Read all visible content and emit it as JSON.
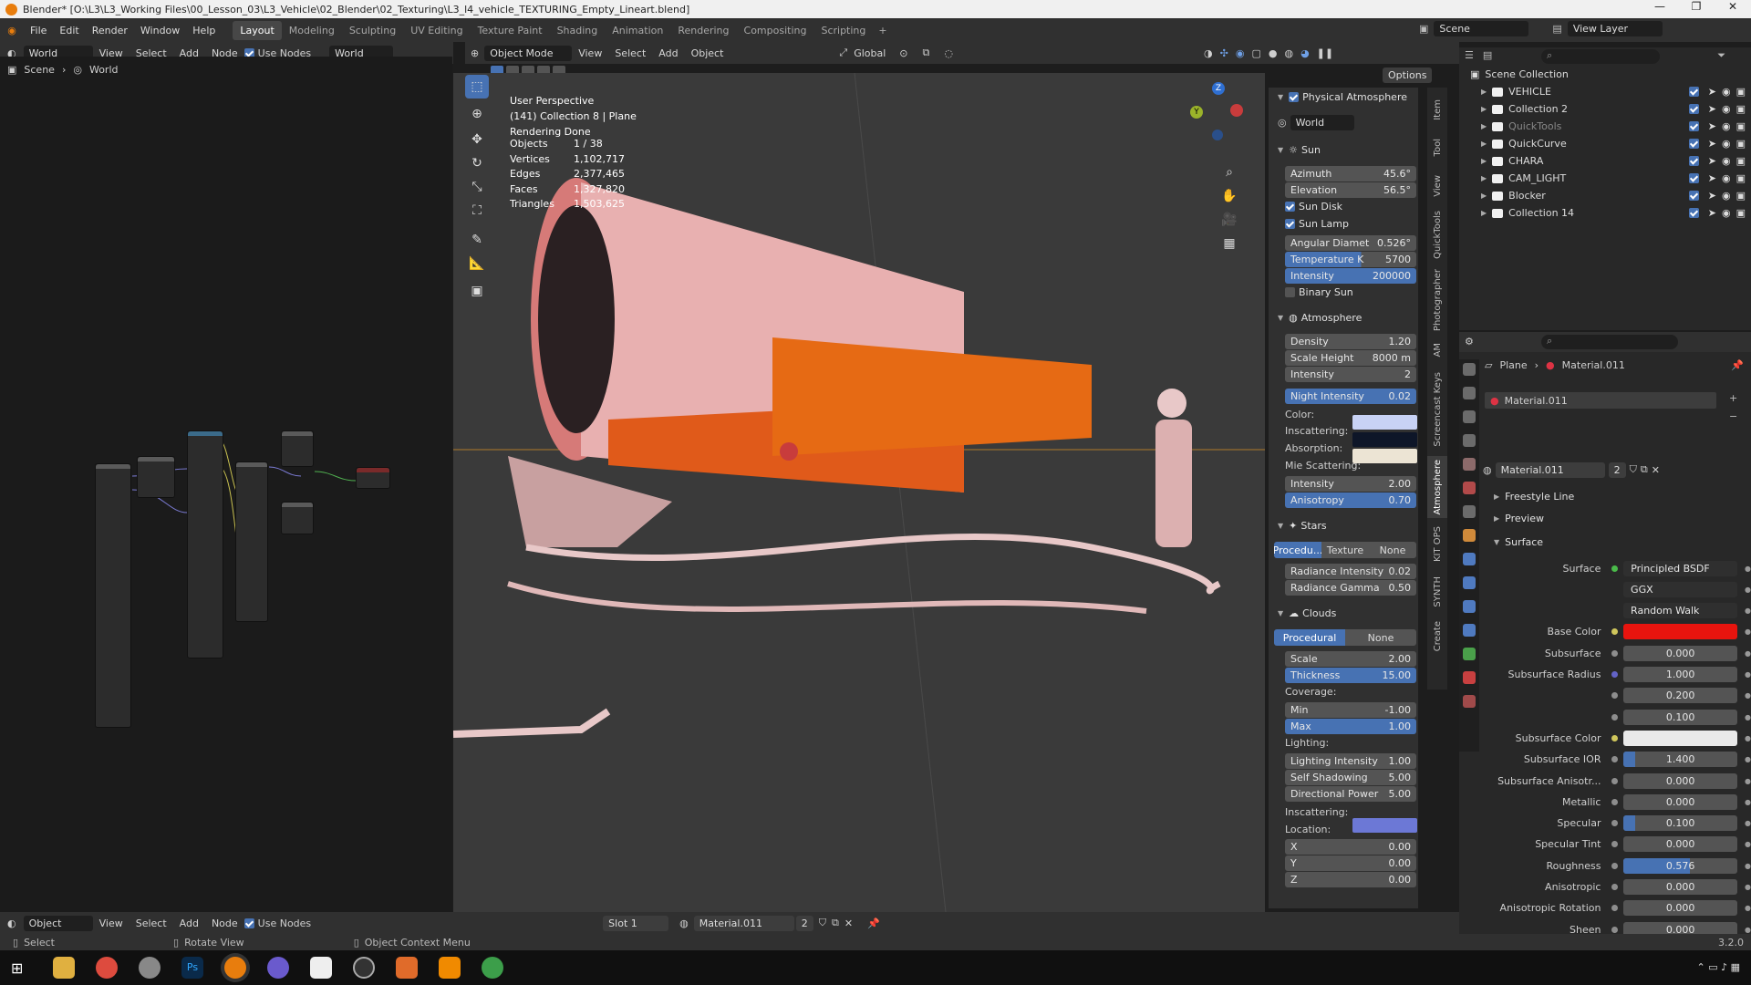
{
  "window": {
    "title": "Blender* [O:\\L3\\L3_Working Files\\00_Lesson_03\\L3_Vehicle\\02_Blender\\02_Texturing\\L3_l4_vehicle_TEXTURING_Empty_Lineart.blend]",
    "minimize": "—",
    "maximize": "❐",
    "close": "✕"
  },
  "topbar": {
    "menus": [
      "File",
      "Edit",
      "Render",
      "Window",
      "Help"
    ],
    "workspaces": [
      "Layout",
      "Modeling",
      "Sculpting",
      "UV Editing",
      "Texture Paint",
      "Shading",
      "Animation",
      "Rendering",
      "Compositing",
      "Scripting"
    ],
    "active_workspace": "Layout",
    "plus": "+",
    "scene_label": "Scene",
    "view_layer_label": "View Layer"
  },
  "node_header": {
    "world_type": "World",
    "menus": [
      "View",
      "Select",
      "Add",
      "Node"
    ],
    "use_nodes": "Use Nodes",
    "world_name": "World",
    "breadcrumb": [
      "Scene",
      "World"
    ]
  },
  "view3d_header": {
    "mode": "Object Mode",
    "menus": [
      "View",
      "Select",
      "Add",
      "Object"
    ],
    "orientation": "Global",
    "options": "Options"
  },
  "viewport": {
    "perspective": "User Perspective",
    "collection_info": "(141) Collection 8 | Plane",
    "render_status": "Rendering Done",
    "stats": [
      {
        "label": "Objects",
        "value": "1 / 38"
      },
      {
        "label": "Vertices",
        "value": "1,102,717"
      },
      {
        "label": "Edges",
        "value": "2,377,465"
      },
      {
        "label": "Faces",
        "value": "1,327,820"
      },
      {
        "label": "Triangles",
        "value": "1,503,625"
      }
    ],
    "gizmo": {
      "z": "Z",
      "y": "Y"
    }
  },
  "physical_atmosphere": {
    "title": "Physical Atmosphere",
    "world": "World",
    "sun": {
      "title": "Sun",
      "azimuth_label": "Azimuth",
      "azimuth": "45.6°",
      "elevation_label": "Elevation",
      "elevation": "56.5°",
      "sun_disk": "Sun Disk",
      "sun_lamp": "Sun Lamp",
      "angular_label": "Angular Diamet",
      "angular": "0.526°",
      "temperature_label": "Temperature K",
      "temperature": "5700",
      "intensity_label": "Intensity",
      "intensity": "200000",
      "binary_sun": "Binary Sun"
    },
    "atmosphere": {
      "title": "Atmosphere",
      "density_label": "Density",
      "density": "1.20",
      "scale_label": "Scale Height",
      "scale": "8000 m",
      "intensity_label": "Intensity",
      "intensity": "2",
      "night_label": "Night Intensity",
      "night": "0.02",
      "color_label": "Color:",
      "inscattering_label": "Inscattering:",
      "absorption_label": "Absorption:",
      "mie_label": "Mie Scattering:",
      "mie_intensity_label": "Intensity",
      "mie_intensity": "2.00",
      "anisotropy_label": "Anisotropy",
      "anisotropy": "0.70"
    },
    "stars": {
      "title": "Stars",
      "modes": [
        "Procedu...",
        "Texture",
        "None"
      ],
      "radiance_intensity_label": "Radiance Intensity",
      "radiance_intensity": "0.02",
      "radiance_gamma_label": "Radiance Gamma",
      "radiance_gamma": "0.50"
    },
    "clouds": {
      "title": "Clouds",
      "modes": [
        "Procedural",
        "None"
      ],
      "scale_label": "Scale",
      "scale": "2.00",
      "thickness_label": "Thickness",
      "thickness": "15.00",
      "coverage_label": "Coverage:",
      "min_label": "Min",
      "min": "-1.00",
      "max_label": "Max",
      "max": "1.00",
      "lighting_label": "Lighting:",
      "lighting_intensity_label": "Lighting Intensity",
      "lighting_intensity": "1.00",
      "self_shadowing_label": "Self Shadowing",
      "self_shadowing": "5.00",
      "directional_label": "Directional Power",
      "directional": "5.00",
      "inscattering_label": "Inscattering:",
      "location_label": "Location:",
      "x_label": "X",
      "x": "0.00",
      "y_label": "Y",
      "y": "0.00",
      "z_label": "Z",
      "z": "0.00"
    }
  },
  "side_tabs": [
    "Item",
    "Tool",
    "View",
    "QuickTools",
    "Photographer",
    "AM",
    "Screencast Keys",
    "Atmosphere",
    "KIT OPS",
    "SYNTH",
    "Create"
  ],
  "outliner": {
    "title": "Scene Collection",
    "items": [
      {
        "name": "VEHICLE"
      },
      {
        "name": "Collection 2"
      },
      {
        "name": "QuickTools"
      },
      {
        "name": "QuickCurve"
      },
      {
        "name": "CHARA"
      },
      {
        "name": "CAM_LIGHT"
      },
      {
        "name": "Blocker"
      },
      {
        "name": "Collection 14"
      }
    ]
  },
  "properties": {
    "breadcrumb": [
      "Plane",
      "Material.011"
    ],
    "slot": "Material.011",
    "material": "Material.011",
    "users": "2",
    "sections": {
      "freestyle": "Freestyle Line",
      "preview": "Preview",
      "surface": "Surface"
    },
    "rows": [
      {
        "label": "Surface",
        "value": "Principled BSDF",
        "kind": "shader"
      },
      {
        "label": "",
        "value": "GGX",
        "kind": "dropdown"
      },
      {
        "label": "",
        "value": "Random Walk",
        "kind": "dropdown"
      },
      {
        "label": "Base Color",
        "value": "",
        "kind": "color",
        "color": "#e8140e"
      },
      {
        "label": "Subsurface",
        "value": "0.000",
        "kind": "num"
      },
      {
        "label": "Subsurface Radius",
        "value": "1.000",
        "kind": "vec"
      },
      {
        "label": "",
        "value": "0.200",
        "kind": "num"
      },
      {
        "label": "",
        "value": "0.100",
        "kind": "num"
      },
      {
        "label": "Subsurface Color",
        "value": "",
        "kind": "color",
        "color": "#e9e9e9"
      },
      {
        "label": "Subsurface IOR",
        "value": "1.400",
        "kind": "num",
        "fill": 0.1
      },
      {
        "label": "Subsurface Anisotr...",
        "value": "0.000",
        "kind": "num"
      },
      {
        "label": "Metallic",
        "value": "0.000",
        "kind": "num"
      },
      {
        "label": "Specular",
        "value": "0.100",
        "kind": "num",
        "fill": 0.1
      },
      {
        "label": "Specular Tint",
        "value": "0.000",
        "kind": "num"
      },
      {
        "label": "Roughness",
        "value": "0.576",
        "kind": "num",
        "fill": 0.576
      },
      {
        "label": "Anisotropic",
        "value": "0.000",
        "kind": "num"
      },
      {
        "label": "Anisotropic Rotation",
        "value": "0.000",
        "kind": "num"
      },
      {
        "label": "Sheen",
        "value": "0.000",
        "kind": "num"
      }
    ]
  },
  "bottom_header": {
    "type": "Object",
    "menus": [
      "View",
      "Select",
      "Add",
      "Node"
    ],
    "use_nodes": "Use Nodes",
    "slot": "Slot 1",
    "material": "Material.011",
    "users": "2"
  },
  "statusbar": {
    "select": "Select",
    "rotate": "Rotate View",
    "context": "Object Context Menu",
    "version": "3.2.0"
  },
  "colors": {
    "atm_color": "#c8d2f5",
    "atm_inscattering": "#0e1628",
    "atm_absorption": "#ece4d4",
    "cloud_inscattering": "#6c78d6",
    "accent": "#4772b3"
  }
}
